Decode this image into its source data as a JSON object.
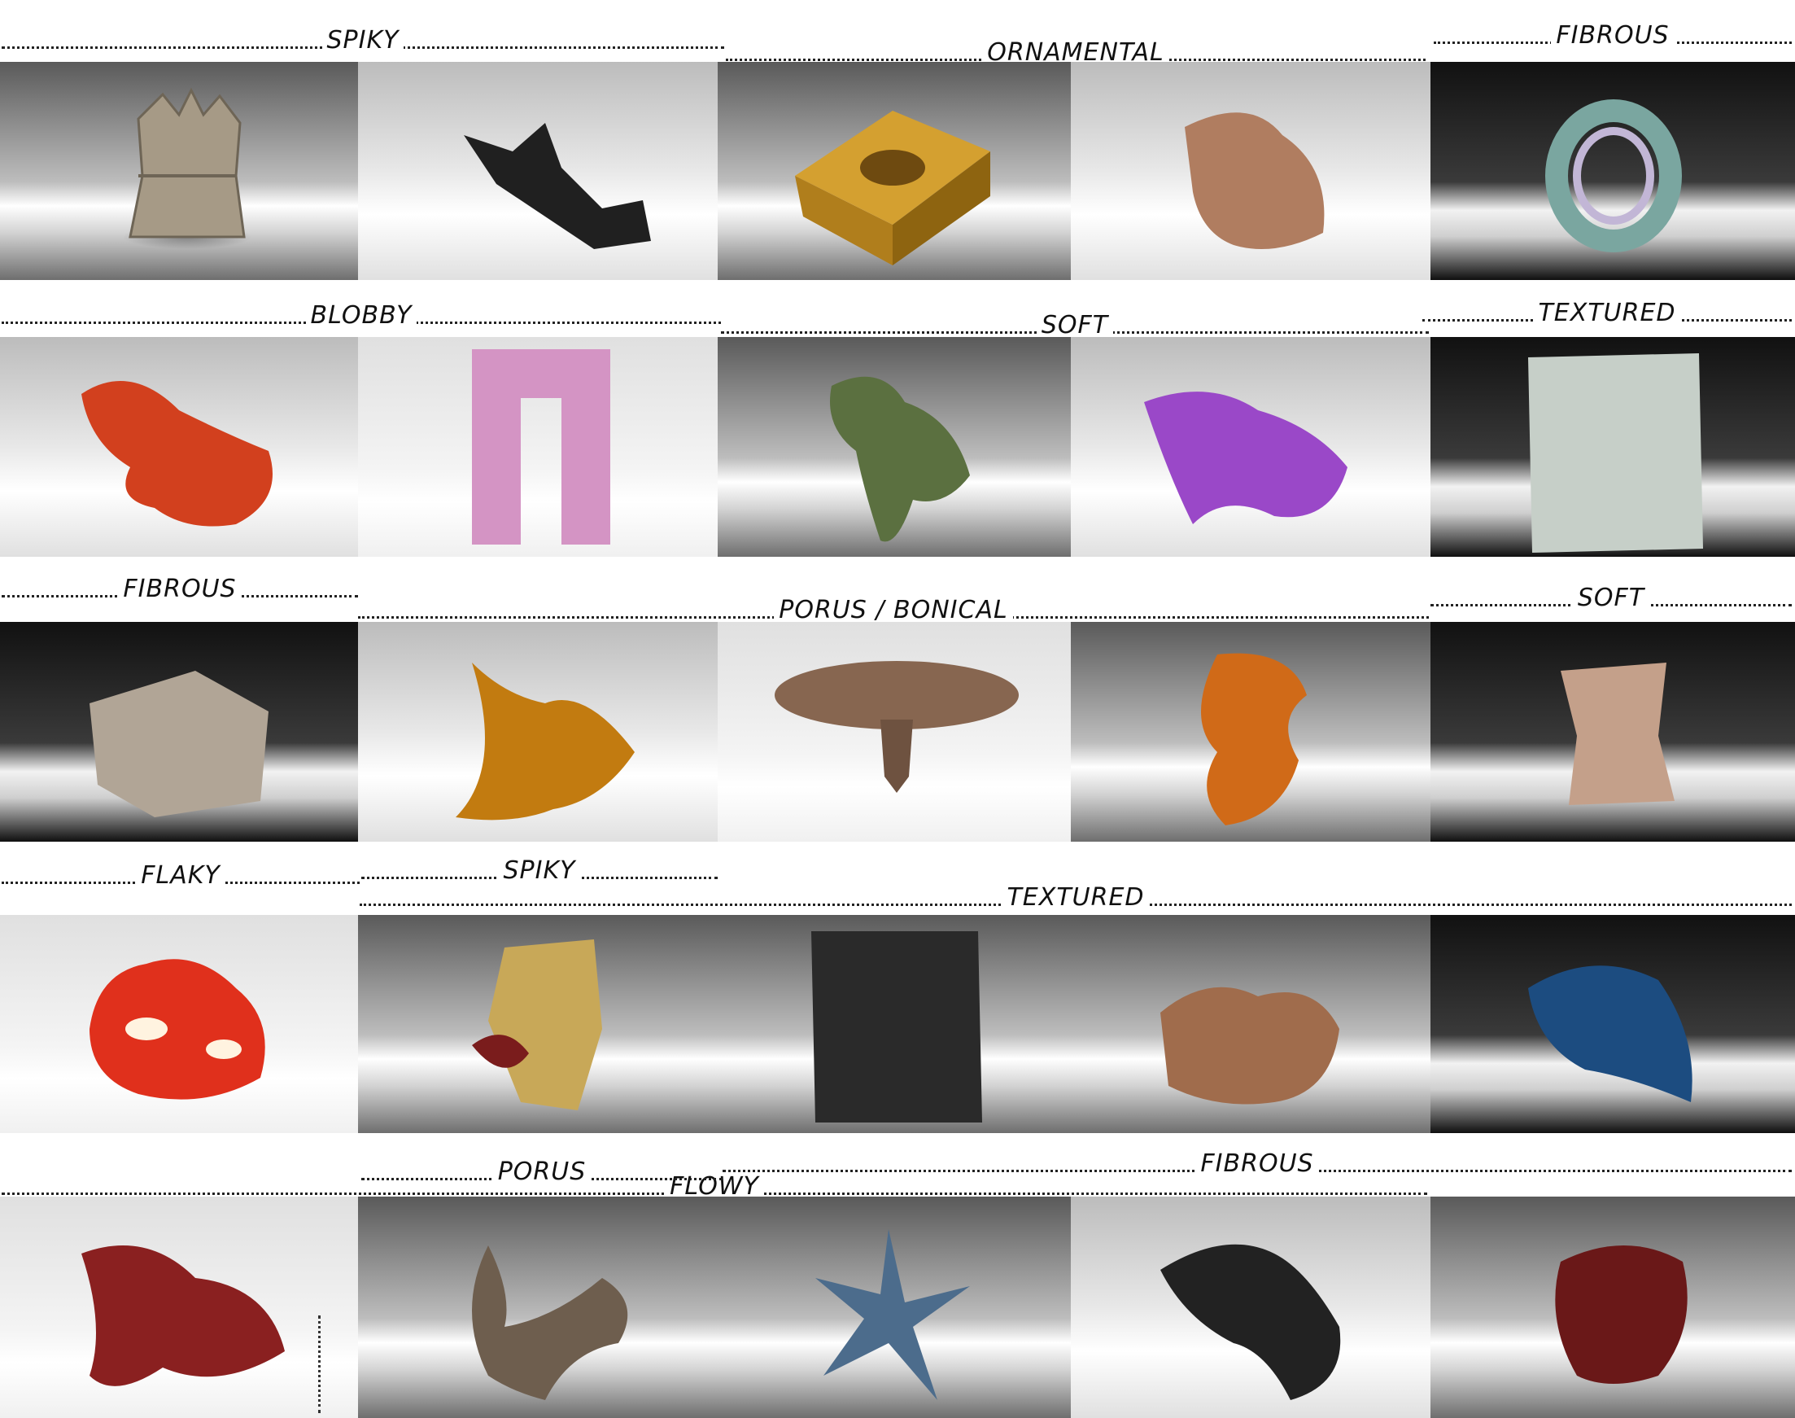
{
  "labels": {
    "r1_spiky": "SPIKY",
    "r1_ornamental": "ORNAMENTAL",
    "r1_fibrous": "FIBROUS",
    "r2_blobby": "BLOBBY",
    "r2_soft": "SOFT",
    "r2_textured": "TEXTURED",
    "r3_fibrous": "FIBROUS",
    "r3_porus_bonical": "PORUS / BONICAL",
    "r3_soft": "SOFT",
    "r4_flaky": "FLAKY",
    "r4_spiky": "SPIKY",
    "r4_textured": "TEXTURED",
    "r5_porus": "PORUS",
    "r5_fibrous": "FIBROUS",
    "r5_flowy": "FLOWY"
  },
  "tiles": [
    {
      "row": 1,
      "col": 1,
      "object": "beige-spiky-form",
      "color": "#a69a86"
    },
    {
      "row": 1,
      "col": 2,
      "object": "black-spiky-form",
      "color": "#202020"
    },
    {
      "row": 1,
      "col": 3,
      "object": "gold-textured-cube",
      "color": "#c8952a"
    },
    {
      "row": 1,
      "col": 4,
      "object": "copper-ornamental-form",
      "color": "#b07d60"
    },
    {
      "row": 1,
      "col": 5,
      "object": "iridescent-fibrous-ring",
      "color": "#7aa6a0"
    },
    {
      "row": 2,
      "col": 1,
      "object": "red-blobby-form",
      "color": "#d2401e"
    },
    {
      "row": 2,
      "col": 2,
      "object": "pink-arch-form",
      "color": "#d494c4"
    },
    {
      "row": 2,
      "col": 3,
      "object": "green-mossy-form",
      "color": "#5b7040"
    },
    {
      "row": 2,
      "col": 4,
      "object": "purple-soft-form",
      "color": "#9a48c8"
    },
    {
      "row": 2,
      "col": 5,
      "object": "pale-textured-slab",
      "color": "#c6cfc8"
    },
    {
      "row": 3,
      "col": 1,
      "object": "stone-fibrous-form",
      "color": "#b1a596"
    },
    {
      "row": 3,
      "col": 2,
      "object": "amber-folded-form",
      "color": "#c27b10"
    },
    {
      "row": 3,
      "col": 3,
      "object": "brown-porous-disc",
      "color": "#876650"
    },
    {
      "row": 3,
      "col": 4,
      "object": "orange-bone-column",
      "color": "#d06a18"
    },
    {
      "row": 3,
      "col": 5,
      "object": "tan-porous-column",
      "color": "#c4a08a"
    },
    {
      "row": 4,
      "col": 1,
      "object": "glowing-red-flaky-form",
      "color": "#e0301c"
    },
    {
      "row": 4,
      "col": 2,
      "object": "gold-spiky-vessel",
      "color": "#c8a858"
    },
    {
      "row": 4,
      "col": 3,
      "object": "charcoal-textured-slab",
      "color": "#2a2a2a"
    },
    {
      "row": 4,
      "col": 4,
      "object": "copper-textured-form",
      "color": "#a06c4c"
    },
    {
      "row": 4,
      "col": 5,
      "object": "blue-glossy-form",
      "color": "#1c4c80"
    },
    {
      "row": 5,
      "col": 1,
      "object": "crimson-flowy-form",
      "color": "#8a2020"
    },
    {
      "row": 5,
      "col": 2,
      "object": "bronze-porous-form",
      "color": "#6e5e4e"
    },
    {
      "row": 5,
      "col": 3,
      "object": "blue-spiky-flowy-form",
      "color": "#4c6c8c"
    },
    {
      "row": 5,
      "col": 4,
      "object": "black-fibrous-form",
      "color": "#222222"
    },
    {
      "row": 5,
      "col": 5,
      "object": "dark-red-lattice-form",
      "color": "#6a1818"
    }
  ]
}
